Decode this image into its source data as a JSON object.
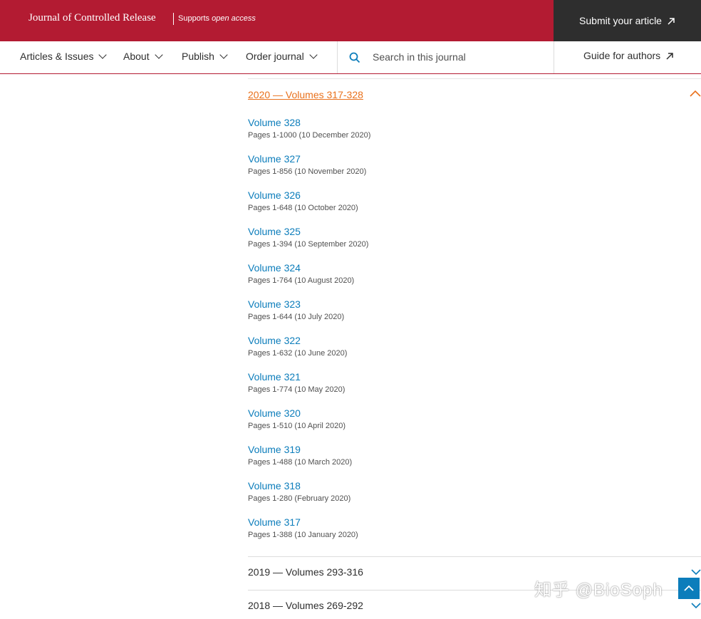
{
  "header": {
    "journal_title": "Journal of Controlled Release",
    "tagline_prefix": "Supports",
    "tagline_emph": "open access",
    "submit_label": "Submit your article"
  },
  "nav": {
    "items": [
      {
        "label": "Articles & Issues"
      },
      {
        "label": "About"
      },
      {
        "label": "Publish"
      },
      {
        "label": "Order journal"
      }
    ],
    "search_placeholder": "Search in this journal",
    "guide_label": "Guide for authors"
  },
  "archive": {
    "expanded_year": "2020 — Volumes 317-328",
    "volumes": [
      {
        "title": "Volume 328",
        "pages": "Pages 1-1000 (10 December 2020)"
      },
      {
        "title": "Volume 327",
        "pages": "Pages 1-856 (10 November 2020)"
      },
      {
        "title": "Volume 326",
        "pages": "Pages 1-648 (10 October 2020)"
      },
      {
        "title": "Volume 325",
        "pages": "Pages 1-394 (10 September 2020)"
      },
      {
        "title": "Volume 324",
        "pages": "Pages 1-764 (10 August 2020)"
      },
      {
        "title": "Volume 323",
        "pages": "Pages 1-644 (10 July 2020)"
      },
      {
        "title": "Volume 322",
        "pages": "Pages 1-632 (10 June 2020)"
      },
      {
        "title": "Volume 321",
        "pages": "Pages 1-774 (10 May 2020)"
      },
      {
        "title": "Volume 320",
        "pages": "Pages 1-510 (10 April 2020)"
      },
      {
        "title": "Volume 319",
        "pages": "Pages 1-488 (10 March 2020)"
      },
      {
        "title": "Volume 318",
        "pages": "Pages 1-280 (February 2020)"
      },
      {
        "title": "Volume 317",
        "pages": "Pages 1-388 (10 January 2020)"
      }
    ],
    "collapsed_years": [
      {
        "label": "2019 — Volumes 293-316"
      },
      {
        "label": "2018 — Volumes 269-292"
      }
    ]
  },
  "watermark": "知乎 @BioSoph",
  "colors": {
    "brand": "#b31b32",
    "link": "#0c7dbb",
    "accent": "#e9711c",
    "dark": "#2e2e2e"
  }
}
